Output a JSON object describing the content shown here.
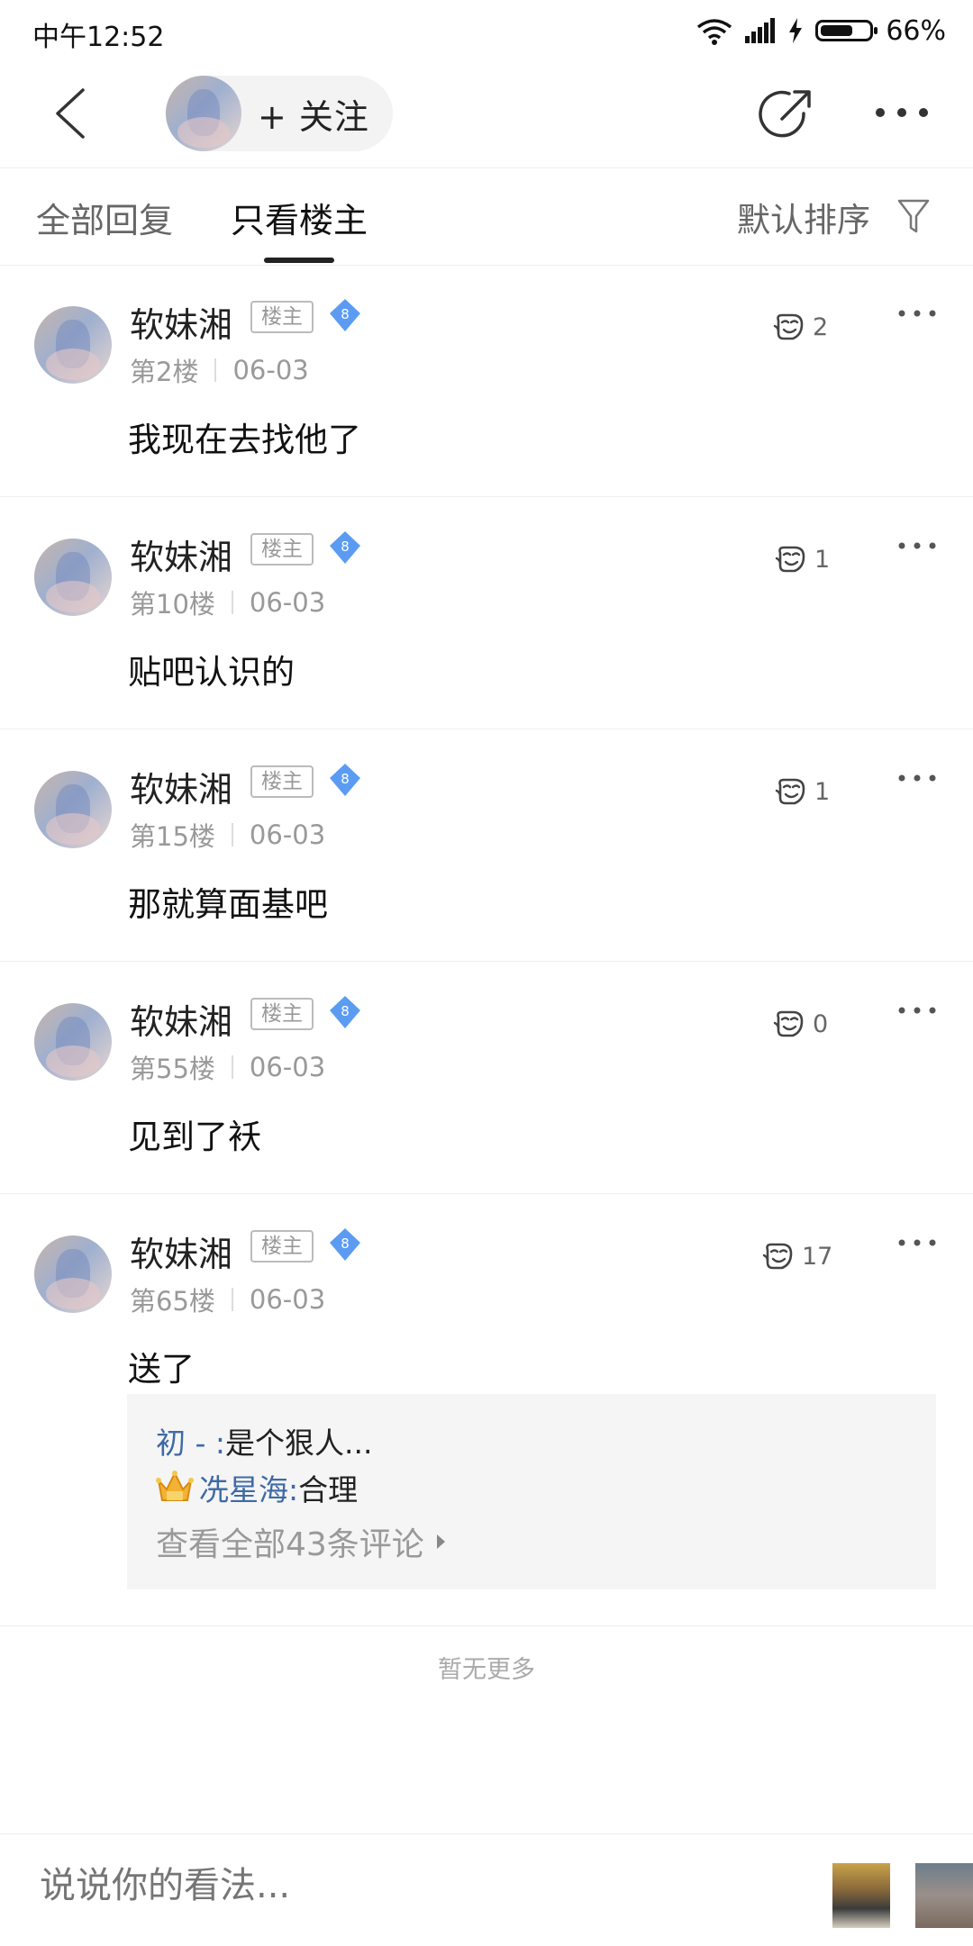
{
  "status_bar": {
    "time": "中午12:52",
    "battery": "66%",
    "battery_level": 0.66
  },
  "nav": {
    "follow_label": "+ 关注"
  },
  "tabs": {
    "all": "全部回复",
    "owner_only": "只看楼主",
    "sort": "默认排序"
  },
  "posts": [
    {
      "author": "软妹湘",
      "badge": "楼主",
      "level": "8",
      "floor": "第2楼",
      "date": "06-03",
      "text": "我现在去找他了",
      "likes": "2"
    },
    {
      "author": "软妹湘",
      "badge": "楼主",
      "level": "8",
      "floor": "第10楼",
      "date": "06-03",
      "text": "贴吧认识的",
      "likes": "1"
    },
    {
      "author": "软妹湘",
      "badge": "楼主",
      "level": "8",
      "floor": "第15楼",
      "date": "06-03",
      "text": "那就算面基吧",
      "likes": "1"
    },
    {
      "author": "软妹湘",
      "badge": "楼主",
      "level": "8",
      "floor": "第55楼",
      "date": "06-03",
      "text": "见到了袄",
      "likes": "0"
    },
    {
      "author": "软妹湘",
      "badge": "楼主",
      "level": "8",
      "floor": "第65楼",
      "date": "06-03",
      "text": "送了",
      "likes": "17"
    }
  ],
  "comments": {
    "items": [
      {
        "name": "初 - :",
        "text": "是个狠人..."
      },
      {
        "name": "冼星海:",
        "text": "合理"
      }
    ],
    "view_all": "查看全部43条评论"
  },
  "footer": {
    "no_more": "暂无更多"
  },
  "bottom_bar": {
    "input_placeholder": "说说你的看法..."
  }
}
